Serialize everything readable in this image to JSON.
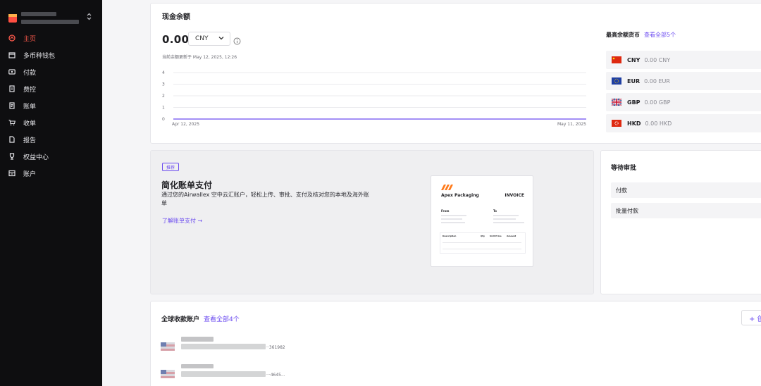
{
  "sidebar": {
    "org_chevron": "⌃⌄",
    "items": [
      {
        "label": "主页",
        "icon": "home-icon",
        "active": true
      },
      {
        "label": "多币种钱包",
        "icon": "wallet-icon",
        "active": false
      },
      {
        "label": "付款",
        "icon": "payment-icon",
        "active": false
      },
      {
        "label": "费控",
        "icon": "expense-icon",
        "active": false
      },
      {
        "label": "账单",
        "icon": "bill-icon",
        "active": false
      },
      {
        "label": "收单",
        "icon": "cart-icon",
        "active": false
      },
      {
        "label": "报告",
        "icon": "report-icon",
        "active": false
      },
      {
        "label": "权益中心",
        "icon": "trophy-icon",
        "active": false
      },
      {
        "label": "账户",
        "icon": "account-icon",
        "active": false
      }
    ]
  },
  "cash": {
    "title": "现金余额",
    "amount": "0.00",
    "currency": "CNY",
    "chevron": "⌄",
    "updated": "当前余额更新于 May 12, 2025, 12:26",
    "chart": {
      "y_ticks": [
        "4",
        "3",
        "2",
        "1",
        "0"
      ],
      "x_start": "Apr 12, 2025",
      "x_end": "May 11, 2025",
      "line_color": "#6c4cf0"
    }
  },
  "top_currencies": {
    "title": "最高余额货币",
    "view_all": "查看全部5个",
    "rows": [
      {
        "code": "CNY",
        "amount": "0.00 CNY",
        "flag": "cn-flag"
      },
      {
        "code": "EUR",
        "amount": "0.00 EUR",
        "flag": "eu-flag"
      },
      {
        "code": "GBP",
        "amount": "0.00 GBP",
        "flag": "gb-flag"
      },
      {
        "code": "HKD",
        "amount": "0.00 HKD",
        "flag": "hk-flag"
      }
    ]
  },
  "promo": {
    "badge": "推荐",
    "title": "简化账单支付",
    "desc": "通过您的Airwallex 空中云汇账户，轻松上传、审批、支付及核对您的本地及海外账单",
    "link": "了解账单支付 →",
    "invoice": {
      "company": "Apex Packaging",
      "title": "INVOICE",
      "from": "From",
      "to": "To",
      "columns": [
        "Description",
        "Qty",
        "Unit Price",
        "Amount"
      ]
    }
  },
  "approvals": {
    "title": "等待审批",
    "items": [
      "付款",
      "批量付款"
    ]
  },
  "global_accounts": {
    "title": "全球收款账户",
    "view_all": "查看全部4个",
    "add": "+ 创",
    "rows": [
      {
        "tail": "··361982"
      },
      {
        "tail": "···4645..."
      }
    ]
  },
  "colors": {
    "accent": "#6c4cf0",
    "brand": "#ff4f42"
  }
}
